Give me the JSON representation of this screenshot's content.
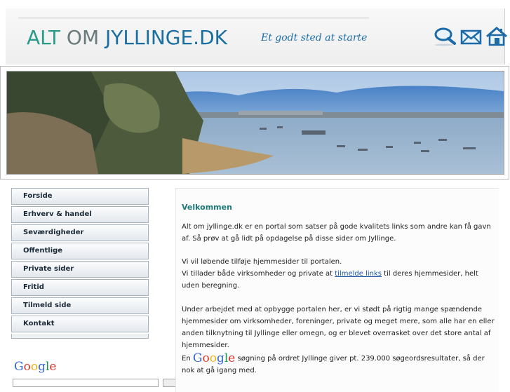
{
  "header": {
    "logo_part1": "ALT",
    "logo_part2": "OM",
    "logo_part3": "JYLLINGE.DK",
    "tagline": "Et godt sted at starte",
    "icons": [
      "search-icon",
      "mail-icon",
      "home-icon"
    ]
  },
  "nav": {
    "items": [
      {
        "label": "Forside"
      },
      {
        "label": "Erhverv & handel"
      },
      {
        "label": "Seværdigheder"
      },
      {
        "label": "Offentlige"
      },
      {
        "label": "Private sider"
      },
      {
        "label": "Fritid"
      },
      {
        "label": "Tilmeld side"
      },
      {
        "label": "Kontakt"
      }
    ]
  },
  "google_box": {
    "logo_text": "Google"
  },
  "content": {
    "title": "Velkommen",
    "p1": "Alt om jyllinge.dk er en portal som satser på gode kvalitets links som andre kan få gavn af. Så prøv at gå lidt på opdagelse på disse sider om Jyllinge.",
    "p2_line1": "Vi vil løbende tilføje hjemmesider til portalen.",
    "p2_line2_a": "Vi tillader både virksomheder og private at ",
    "p2_link": "tilmelde links",
    "p2_line2_b": " til deres hjemmesider, helt uden beregning.",
    "p3": "Under arbejdet med at opbygge portalen her, er vi stødt på rigtig mange spændende hjemmesider om virksomheder, foreninger, private og meget mere, som alle har en eller anden tilknytning til Jyllinge eller omegn, og er blevet overrasket over det store antal af hjemmesider.",
    "p4_prefix": "En",
    "p4_logo": "Google",
    "p4_text": " søgning på ordret Jyllinge giver pt. 239.000 søgeordsresultater, så der nok at gå igang med."
  },
  "colors": {
    "logo_teal": "#2a9a8a",
    "logo_grey": "#6a7a7a",
    "logo_blue": "#1a6ea0",
    "heading_teal": "#1a7a78",
    "link_blue": "#1a55a8"
  }
}
